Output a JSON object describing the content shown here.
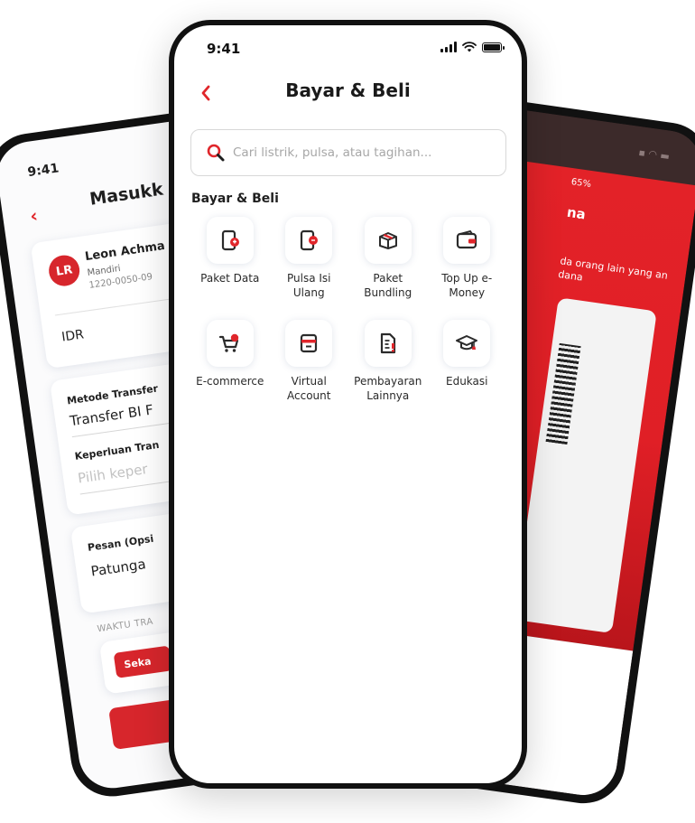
{
  "colors": {
    "accent": "#E0262B",
    "text": "#1F1F1F",
    "icon_dark": "#2B2B2B"
  },
  "left_phone": {
    "time": "9:41",
    "title": "Masukk",
    "avatar_initials": "LR",
    "recipient_name": "Leon Achma",
    "bank": "Mandiri",
    "account": "1220-0050-09",
    "currency": "IDR",
    "transfer_method_label": "Metode Transfer",
    "transfer_method_value": "Transfer BI F",
    "purpose_label": "Keperluan Tran",
    "purpose_placeholder": "Pilih keper",
    "message_label": "Pesan (Opsi",
    "message_value": "Patunga",
    "time_section_label": "WAKTU TRA",
    "now_button": "Seka"
  },
  "right_phone": {
    "status": "65%",
    "title": "na",
    "text": "da orang lain yang an dana"
  },
  "main": {
    "status": {
      "time": "9:41"
    },
    "nav": {
      "back_icon": "chevron-left-icon",
      "title": "Bayar & Beli"
    },
    "search": {
      "placeholder": "Cari listrik, pulsa, atau tagihan..."
    },
    "section_title": "Bayar & Beli",
    "menu": [
      {
        "label": "Paket Data",
        "icon": "data-package-icon"
      },
      {
        "label": "Pulsa Isi\nUlang",
        "icon": "phone-credit-icon"
      },
      {
        "label": "Paket\nBundling",
        "icon": "bundle-box-icon"
      },
      {
        "label": "Top Up e-\nMoney",
        "icon": "wallet-icon"
      },
      {
        "label": "E-commerce",
        "icon": "shopping-cart-icon"
      },
      {
        "label": "Virtual\nAccount",
        "icon": "virtual-account-icon"
      },
      {
        "label": "Pembayaran\nLainnya",
        "icon": "bill-document-icon"
      },
      {
        "label": "Edukasi",
        "icon": "graduation-cap-icon"
      }
    ]
  }
}
